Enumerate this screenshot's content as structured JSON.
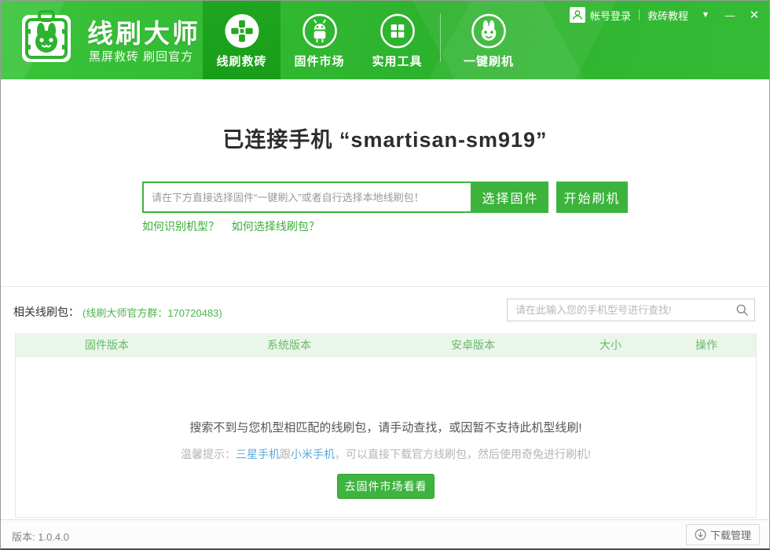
{
  "colors": {
    "brand_green": "#2eb32e",
    "button_green": "#3cb43c",
    "active_tab_green": "#1fa51f",
    "table_header_bg": "#ebf6ea",
    "table_header_text": "#68b96b",
    "link_green": "#3aad3a",
    "link_blue": "#57a9dc"
  },
  "header": {
    "title": "线刷大师",
    "subtitle": "黑屏救砖 刷回官方",
    "login_label": "帐号登录",
    "tutorial_label": "救砖教程",
    "caret_glyph": "▼",
    "minimize_glyph": "—",
    "close_glyph": "✕"
  },
  "nav": {
    "items": [
      {
        "label": "线刷救砖",
        "icon": "dpad-icon",
        "active": true
      },
      {
        "label": "固件市场",
        "icon": "android-icon",
        "active": false
      },
      {
        "label": "实用工具",
        "icon": "grid-icon",
        "active": false
      },
      {
        "label": "一键刷机",
        "icon": "rabbit-icon",
        "active": false
      }
    ]
  },
  "main": {
    "connected_title": "已连接手机 “smartisan-sm919”",
    "firmware_input_placeholder": "请在下方直接选择固件“一键刷入”或者自行选择本地线刷包！",
    "select_firmware_label": "选择固件",
    "start_flash_label": "开始刷机",
    "help_link_1": "如何识别机型？",
    "help_link_2": "如何选择线刷包？"
  },
  "related": {
    "label": "相关线刷包：",
    "group_info": "(线刷大师官方群：170720483)",
    "search_placeholder": "请在此输入您的手机型号进行查找!",
    "table_headers": [
      "固件版本",
      "系统版本",
      "安卓版本",
      "大小",
      "操作"
    ],
    "empty_message": "搜索不到与您机型相匹配的线刷包，请手动查找，或因暂不支持此机型线刷!",
    "tip_prefix": "温馨提示：",
    "tip_link_samsung": "三星手机",
    "tip_middle": "跟",
    "tip_link_xiaomi": "小米手机",
    "tip_suffix": "，可以直接下载官方线刷包，然后使用奇兔进行刷机!",
    "market_button_label": "去固件市场看看"
  },
  "footer": {
    "version": "版本: 1.0.4.0",
    "download_manager_label": "下载管理"
  }
}
